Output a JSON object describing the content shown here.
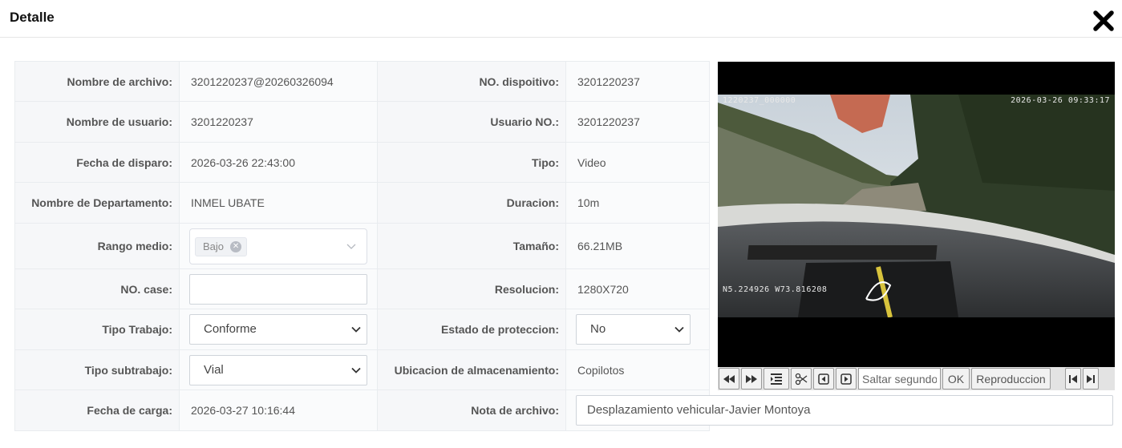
{
  "header": {
    "title": "Detalle"
  },
  "fields": {
    "nombre_archivo": {
      "label": "Nombre de archivo:",
      "value": "3201220237@20260326094"
    },
    "no_dispositivo": {
      "label": "NO. dispoitivo:",
      "value": "3201220237"
    },
    "nombre_usuario": {
      "label": "Nombre de usuario:",
      "value": "3201220237"
    },
    "usuario_no": {
      "label": "Usuario NO.:",
      "value": "3201220237"
    },
    "fecha_disparo": {
      "label": "Fecha de disparo:",
      "value": "2026-03-26 22:43:00"
    },
    "tipo": {
      "label": "Tipo:",
      "value": "Video"
    },
    "departamento": {
      "label": "Nombre de Departamento:",
      "value": "INMEL UBATE"
    },
    "duracion": {
      "label": "Duracion:",
      "value": "10m"
    },
    "rango_medio": {
      "label": "Rango medio:",
      "tag": "Bajo"
    },
    "tamano": {
      "label": "Tamaño:",
      "value": "66.21MB"
    },
    "no_case": {
      "label": "NO. case:",
      "value": ""
    },
    "resolucion": {
      "label": "Resolucion:",
      "value": "1280X720"
    },
    "tipo_trabajo": {
      "label": "Tipo Trabajo:",
      "value": "Conforme"
    },
    "estado_proteccion": {
      "label": "Estado de proteccion:",
      "value": "No"
    },
    "tipo_subtrabajo": {
      "label": "Tipo subtrabajo:",
      "value": "Vial"
    },
    "ubicacion": {
      "label": "Ubicacion de almacenamiento:",
      "value": "Copilotos"
    },
    "fecha_carga": {
      "label": "Fecha de carga:",
      "value": "2026-03-27 10:16:44"
    },
    "nota_archivo": {
      "label": "Nota de archivo:",
      "value": "Desplazamiento vehicular-Javier Montoya"
    }
  },
  "video": {
    "osd_top_left": "1220237_000000",
    "osd_top_right": "2026-03-26  09:33:17",
    "osd_gps": "N5.224926  W73.816208"
  },
  "player": {
    "seek_placeholder": "Saltar segundos",
    "ok_label": "OK",
    "playback_label": "Reproduccion"
  }
}
